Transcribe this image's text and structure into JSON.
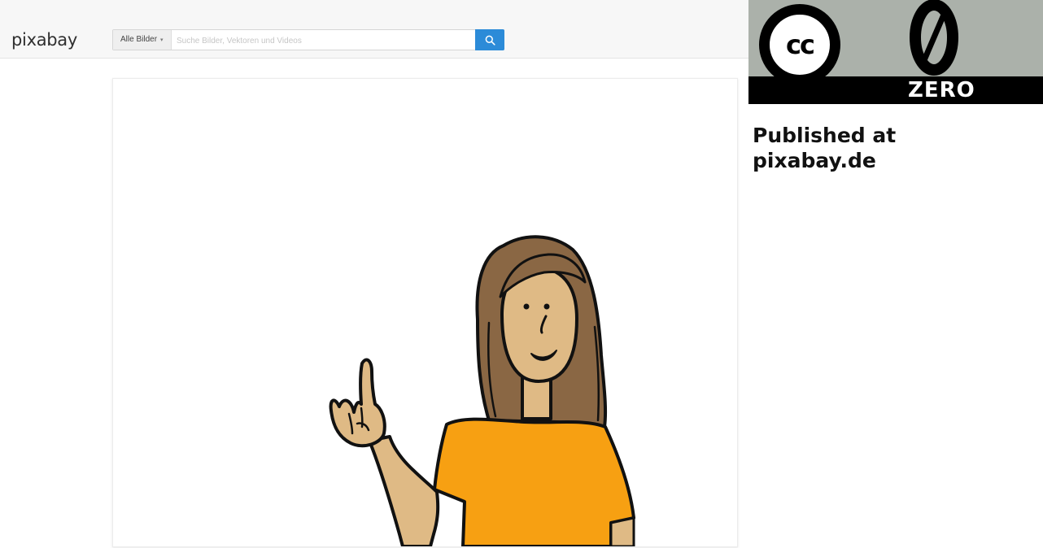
{
  "header": {
    "logo_text": "pixabay",
    "search": {
      "filter_label": "Alle Bilder",
      "filter_caret": "▾",
      "placeholder": "Suche Bilder, Vektoren und Videos",
      "value": "",
      "button_icon": "search-icon"
    }
  },
  "main_image": {
    "subject": "cartoon-woman-raising-index-finger",
    "colors": {
      "skin": "#dfba85",
      "hair": "#8a6744",
      "shirt": "#f7a012",
      "outline": "#111111"
    }
  },
  "license_badge": {
    "cc_label": "cc",
    "zero_glyph": "0",
    "zero_label": "ZERO",
    "colors": {
      "badge_bg": "#abb1aa",
      "strip_bg": "#000000"
    }
  },
  "published": {
    "line1": "Published at",
    "line2": "pixabay.de"
  },
  "colors": {
    "accent": "#2c8bd8",
    "topbar_bg": "#f7f7f7"
  }
}
